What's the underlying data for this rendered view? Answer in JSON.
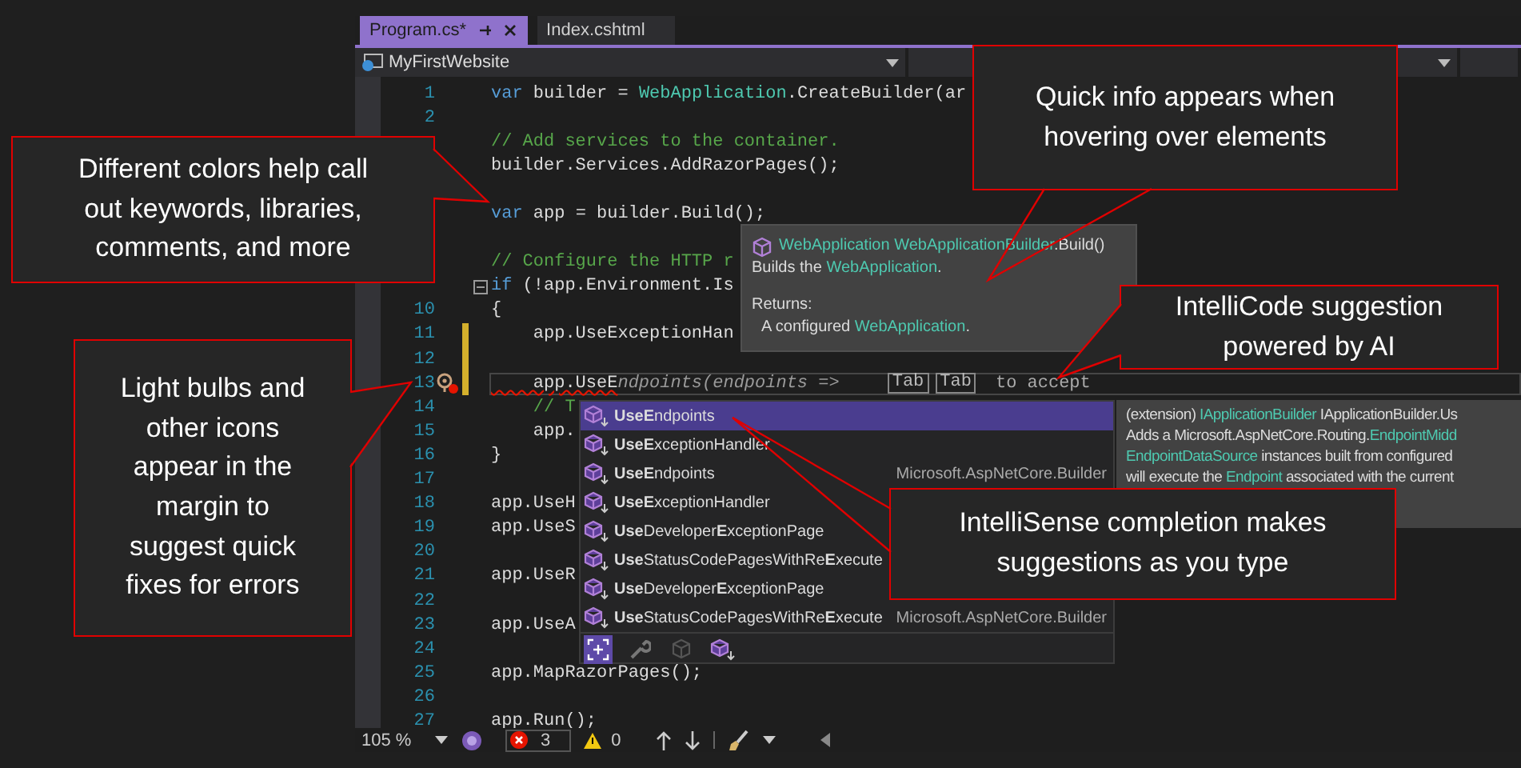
{
  "tabs": [
    {
      "label": "Program.cs*",
      "selected": true,
      "pinnable": true
    },
    {
      "label": "Index.cshtml",
      "selected": false,
      "pinnable": false
    }
  ],
  "navbar": {
    "project": "MyFirstWebsite"
  },
  "lines": [
    {
      "number": "1",
      "tokens": [
        {
          "kind": "keyword",
          "text": "var"
        },
        {
          "kind": "plain",
          "text": " builder = "
        },
        {
          "kind": "type",
          "text": "WebApplication"
        },
        {
          "kind": "plain",
          "text": ".CreateBuilder(ar"
        }
      ]
    },
    {
      "number": "2"
    },
    {
      "tokens": [
        {
          "kind": "comment",
          "text": "// Add services to the container."
        }
      ]
    },
    {
      "tokens": [
        {
          "kind": "plain",
          "text": "builder.Services.AddRazorPages();"
        }
      ],
      "blank_after": true
    },
    {
      "tokens": [
        {
          "kind": "keyword",
          "text": "var"
        },
        {
          "kind": "plain",
          "text": " app = builder.Build();"
        }
      ],
      "blank_after": true
    },
    {
      "tokens": [
        {
          "kind": "comment",
          "text": "// Configure the HTTP r"
        }
      ]
    },
    {
      "fold": true,
      "tokens": [
        {
          "kind": "keyword",
          "text": "if"
        },
        {
          "kind": "plain",
          "text": " (!app.Environment.Is"
        }
      ]
    },
    {
      "number": "10",
      "tokens": [
        {
          "kind": "plain",
          "text": "{"
        }
      ]
    },
    {
      "number": "11",
      "changed": true,
      "tokens": [
        {
          "kind": "plain",
          "text": "    app.UseExceptionHan"
        }
      ]
    },
    {
      "number": "12",
      "changed": true
    },
    {
      "number": "13",
      "changed": true,
      "bulb": true,
      "current": true,
      "tokens": [
        {
          "kind": "error",
          "text": "    app.UseE"
        },
        {
          "kind": "ghost",
          "text": "ndpoints(endpoints =>"
        }
      ],
      "keys": [
        "Tab",
        "Tab"
      ],
      "hint": "to accept"
    },
    {
      "number": "14",
      "tokens": [
        {
          "kind": "comment",
          "text": "    // T"
        }
      ]
    },
    {
      "number": "15",
      "tokens": [
        {
          "kind": "plain",
          "text": "    app."
        }
      ]
    },
    {
      "number": "16",
      "tokens": [
        {
          "kind": "plain",
          "text": "}"
        }
      ]
    },
    {
      "number": "17"
    },
    {
      "number": "18",
      "tokens": [
        {
          "kind": "plain",
          "text": "app.UseH"
        }
      ]
    },
    {
      "number": "19",
      "tokens": [
        {
          "kind": "plain",
          "text": "app.UseS"
        }
      ]
    },
    {
      "number": "20"
    },
    {
      "number": "21",
      "tokens": [
        {
          "kind": "plain",
          "text": "app.UseR"
        }
      ]
    },
    {
      "number": "22"
    },
    {
      "number": "23",
      "tokens": [
        {
          "kind": "plain",
          "text": "app.UseA"
        }
      ]
    },
    {
      "number": "24"
    },
    {
      "number": "25",
      "tokens": [
        {
          "kind": "plain",
          "text": "app.MapRazorPages();"
        }
      ]
    },
    {
      "number": "26"
    },
    {
      "number": "27",
      "tokens": [
        {
          "kind": "plain",
          "text": "app.Run();"
        }
      ]
    }
  ],
  "quick_info": {
    "signature": [
      {
        "kind": "type",
        "text": "WebApplication WebApplicationBuilder"
      },
      {
        "kind": "plain",
        "text": ".Build()"
      }
    ],
    "summary": [
      {
        "kind": "plain",
        "text": "Builds the "
      },
      {
        "kind": "type",
        "text": "WebApplication"
      },
      {
        "kind": "plain",
        "text": "."
      }
    ],
    "returns_label": "Returns:",
    "returns": [
      {
        "kind": "plain",
        "text": "A configured "
      },
      {
        "kind": "type",
        "text": "WebApplication"
      },
      {
        "kind": "plain",
        "text": "."
      }
    ]
  },
  "completion": {
    "items": [
      {
        "label": "**UseE**ndpoints",
        "selected": true
      },
      {
        "label": "**UseE**xceptionHandler",
        "selected": false
      },
      {
        "label": "**UseE**ndpoints",
        "selected": false,
        "detail": "Microsoft.AspNetCore.Builder"
      },
      {
        "label": "**UseE**xceptionHandler",
        "selected": false
      },
      {
        "label": "**Use**Developer**E**xceptionPage",
        "selected": false
      },
      {
        "label": "**Use**StatusCodePagesWithRe**E**xecute",
        "selected": false
      },
      {
        "label": "**Use**Developer**E**xceptionPage",
        "selected": false
      },
      {
        "label": "**Use**StatusCodePagesWithRe**E**xecute",
        "selected": false,
        "detail": "Microsoft.AspNetCore.Builder"
      }
    ],
    "filters": [
      {
        "kind": "snippet",
        "selected": true
      },
      {
        "kind": "wrench",
        "selected": false
      },
      {
        "kind": "cube",
        "selected": false
      },
      {
        "kind": "method",
        "selected": false
      }
    ],
    "description": [
      [
        {
          "kind": "plain",
          "text": "(extension) "
        },
        {
          "kind": "type",
          "text": "IApplicationBuilder"
        },
        {
          "kind": "plain",
          "text": " IApplicationBuilder.Us"
        }
      ],
      [
        {
          "kind": "plain",
          "text": "Adds a Microsoft.AspNetCore.Routing."
        },
        {
          "kind": "type",
          "text": "EndpointMidd"
        }
      ],
      [
        {
          "kind": "type",
          "text": "EndpointDataSource"
        },
        {
          "kind": "plain",
          "text": " instances built from configured"
        }
      ],
      [
        {
          "kind": "plain",
          "text": "will execute the "
        },
        {
          "kind": "type",
          "text": "Endpoint"
        },
        {
          "kind": "plain",
          "text": " associated with the current"
        }
      ]
    ]
  },
  "status_bar": {
    "zoom": "105 %",
    "errors": "3",
    "warnings": "0"
  },
  "callouts": [
    {
      "lines": [
        "Different colors help call",
        "out keywords, libraries,",
        "comments, and more"
      ]
    },
    {
      "lines": [
        "Light bulbs and",
        "other icons",
        "appear in the",
        "margin to",
        "suggest quick",
        "fixes for errors"
      ]
    },
    {
      "lines": [
        "Quick info appears when",
        "hovering over elements"
      ]
    },
    {
      "lines": [
        "IntelliCode suggestion",
        "powered by AI"
      ]
    },
    {
      "lines": [
        "IntelliSense completion makes",
        "suggestions as you type"
      ]
    }
  ]
}
